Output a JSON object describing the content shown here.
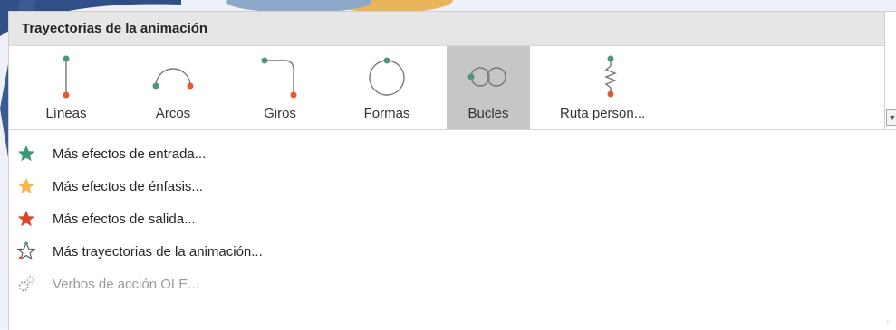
{
  "header": {
    "title": "Trayectorias de la animación"
  },
  "gallery": {
    "tiles": [
      {
        "label": "Líneas",
        "icon": "line-path-icon"
      },
      {
        "label": "Arcos",
        "icon": "arc-path-icon"
      },
      {
        "label": "Giros",
        "icon": "turn-path-icon"
      },
      {
        "label": "Formas",
        "icon": "shape-path-icon"
      },
      {
        "label": "Bucles",
        "icon": "loop-path-icon",
        "selected": true
      },
      {
        "label": "Ruta person...",
        "icon": "custom-path-icon"
      }
    ]
  },
  "menu": {
    "items": [
      {
        "label": "Más efectos de entrada...",
        "icon": "entrance-star-icon",
        "color": "#3a9a78"
      },
      {
        "label": "Más efectos de énfasis...",
        "icon": "emphasis-star-icon",
        "color": "#f2b84b"
      },
      {
        "label": "Más efectos de salida...",
        "icon": "exit-star-icon",
        "color": "#d9472b"
      },
      {
        "label": "Más trayectorias de la animación...",
        "icon": "motion-path-star-icon"
      },
      {
        "label": "Verbos de acción OLE...",
        "icon": "ole-action-icon",
        "disabled": true
      }
    ]
  },
  "colors": {
    "start_dot": "#4a9a7a",
    "end_dot": "#e05a35",
    "selected_bg": "#c6c6c6",
    "header_bg": "#e6e6e6"
  }
}
